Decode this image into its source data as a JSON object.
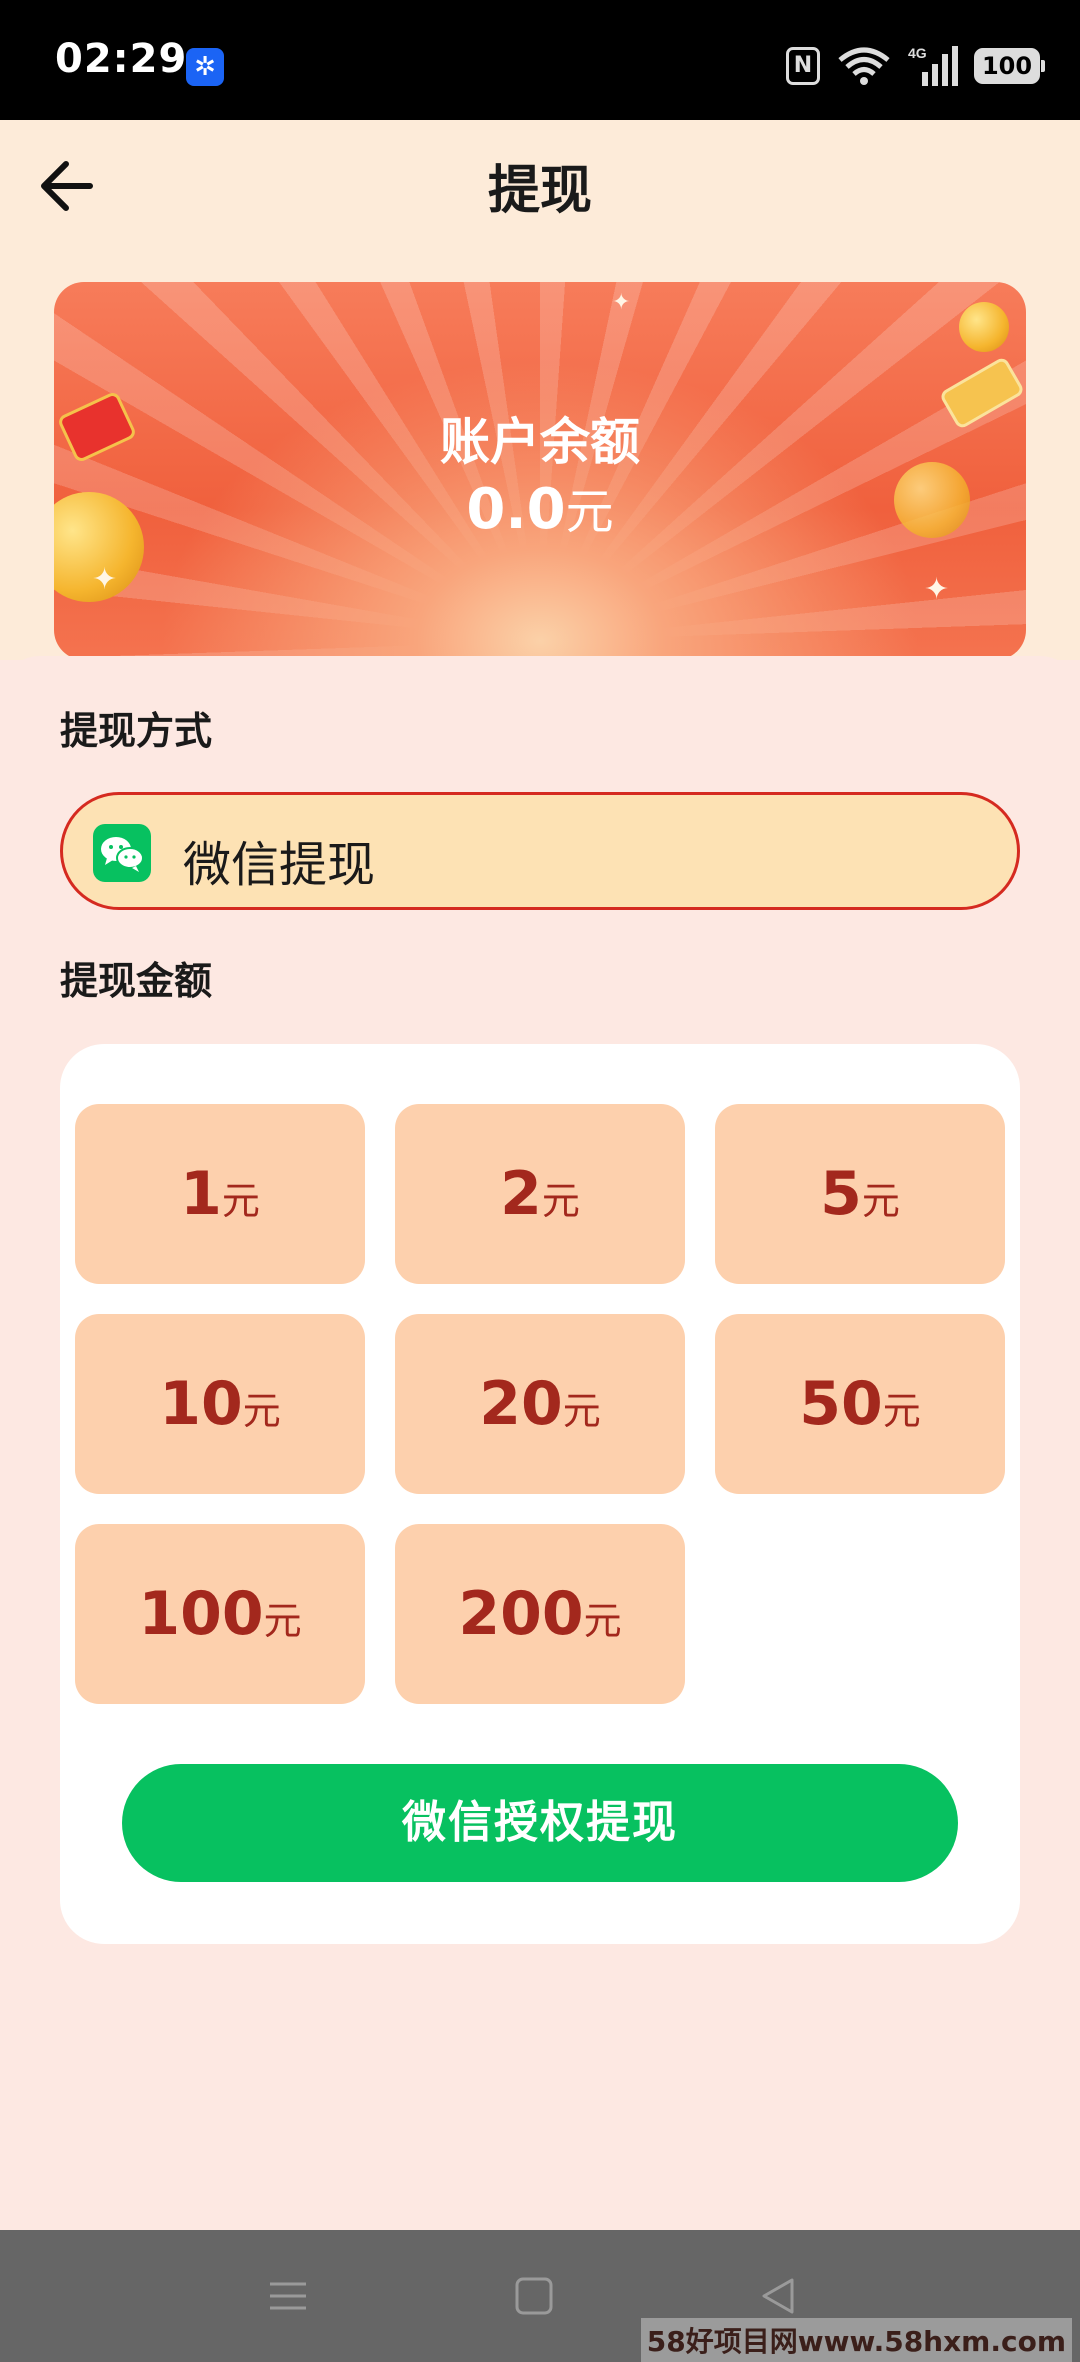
{
  "status_bar": {
    "time": "02:29",
    "app_icon": "pinwheel-icon",
    "nfc_label": "N",
    "battery": "100"
  },
  "header": {
    "back_icon": "arrow-left-icon",
    "title": "提现"
  },
  "balance": {
    "label": "账户余额",
    "value": "0.0",
    "unit": "元"
  },
  "withdraw_method": {
    "section_label": "提现方式",
    "option": {
      "icon": "wechat-icon",
      "label": "微信提现"
    }
  },
  "withdraw_amount": {
    "section_label": "提现金额",
    "unit": "元",
    "options": [
      {
        "value": "1"
      },
      {
        "value": "2"
      },
      {
        "value": "5"
      },
      {
        "value": "10"
      },
      {
        "value": "20"
      },
      {
        "value": "50"
      },
      {
        "value": "100"
      },
      {
        "value": "200"
      }
    ]
  },
  "submit": {
    "label": "微信授权提现"
  },
  "nav_bar": {
    "menu_icon": "menu-icon",
    "home_icon": "home-square-icon",
    "back_icon": "back-triangle-icon"
  },
  "watermark": "58好项目网www.58hxm.com",
  "colors": {
    "accent_green": "#07c160",
    "amount_bg": "#fdd0ad",
    "amount_text": "#a3281d",
    "method_border": "#d52a20"
  }
}
